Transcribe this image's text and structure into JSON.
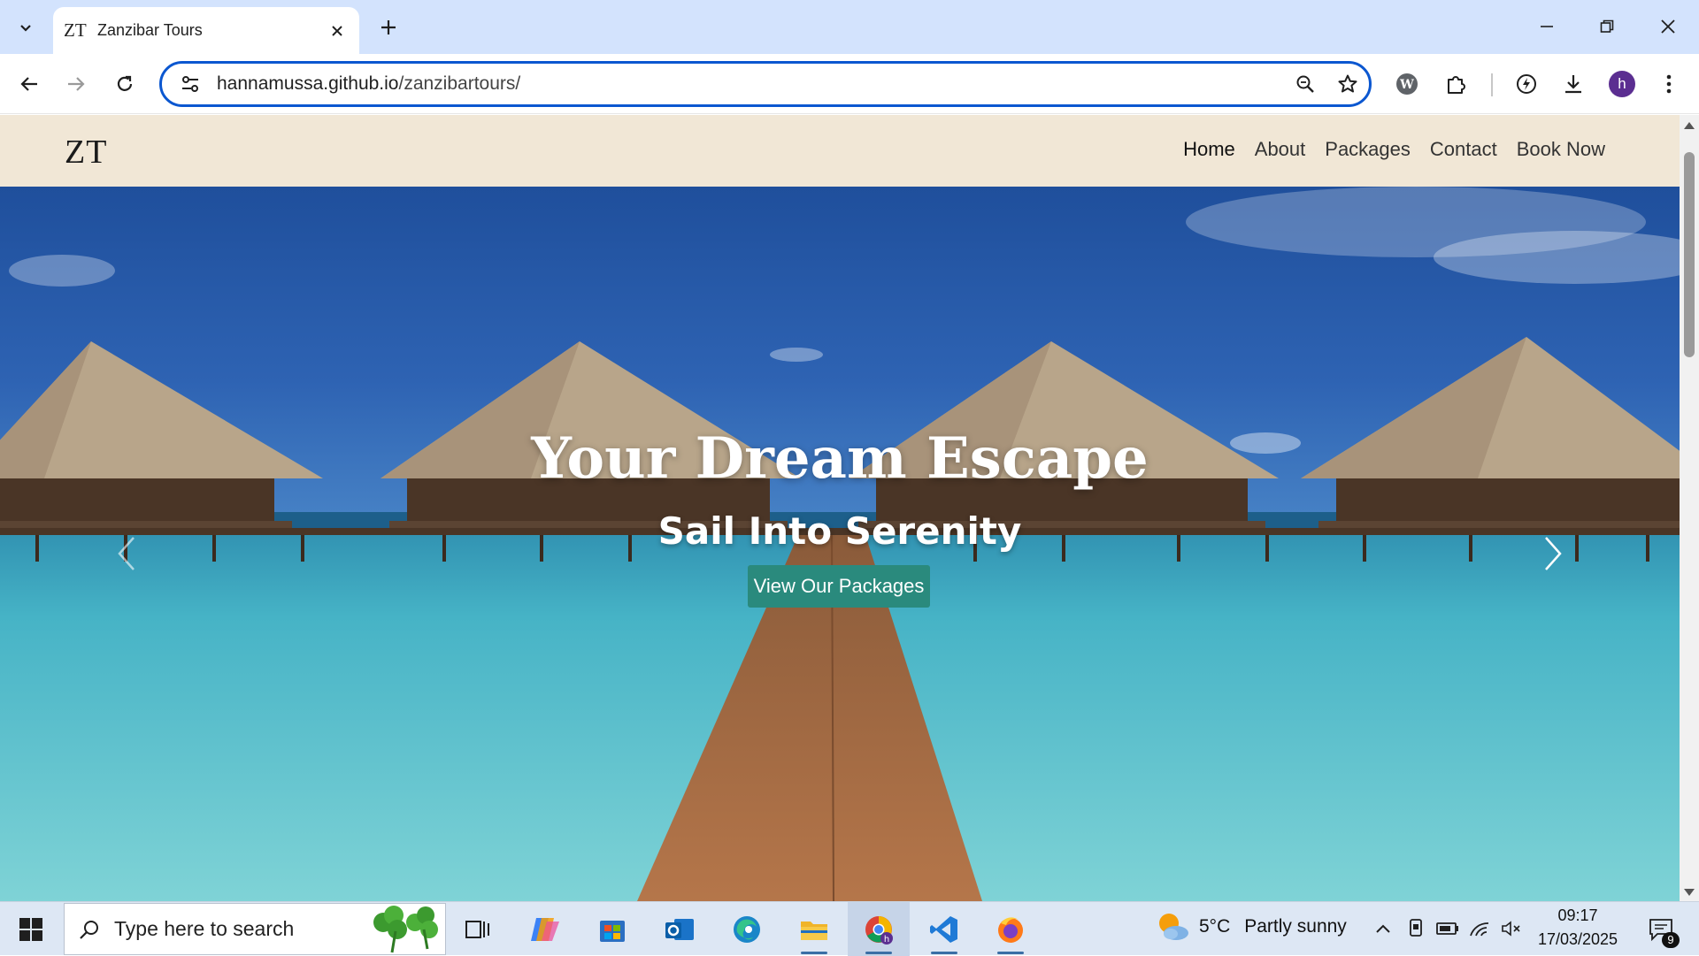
{
  "browser": {
    "tab": {
      "favicon_text": "ZT",
      "title": "Zanzibar Tours"
    },
    "url_host": "hannamussa.github.io",
    "url_path": "/zanzibartours/",
    "avatar_letter": "h"
  },
  "site": {
    "logo": "ZT",
    "nav": [
      {
        "label": "Home",
        "active": true
      },
      {
        "label": "About"
      },
      {
        "label": "Packages"
      },
      {
        "label": "Contact"
      },
      {
        "label": "Book Now"
      }
    ]
  },
  "hero": {
    "title": "Your Dream Escape",
    "subtitle": "Sail Into Serenity",
    "cta_label": "View Our Packages",
    "button_color": "#2a8a7d"
  },
  "taskbar": {
    "search_placeholder": "Type here to search",
    "apps": [
      "task-view-icon",
      "copilot-icon",
      "store-icon",
      "outlook-icon",
      "edge-icon",
      "file-explorer-icon",
      "chrome-icon",
      "vscode-icon",
      "firefox-icon"
    ],
    "weather_temp": "5°C",
    "weather_desc": "Partly sunny",
    "time": "09:17",
    "date": "17/03/2025",
    "notification_count": "9"
  },
  "colors": {
    "tabbar_bg": "#d3e3fd",
    "nav_bg": "#f1e7d6",
    "omnibox_border": "#0b57d0",
    "taskbar_bg": "#dde7f4"
  }
}
